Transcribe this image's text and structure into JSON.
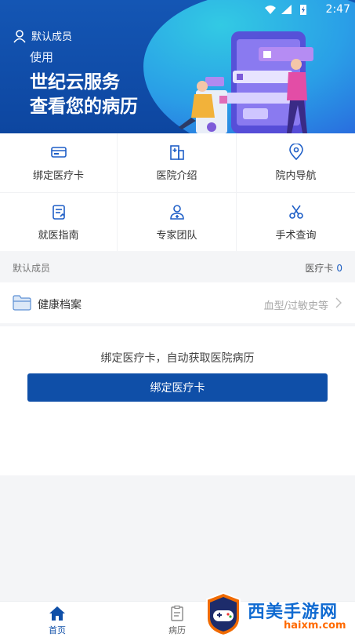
{
  "status": {
    "time": "2:47"
  },
  "hero": {
    "member_label": "默认成员",
    "use_text": "使用",
    "title_line1": "世纪云服务",
    "title_line2": "查看您的病历"
  },
  "grid": [
    {
      "label": "绑定医疗卡",
      "icon": "card-icon"
    },
    {
      "label": "医院介绍",
      "icon": "hospital-icon"
    },
    {
      "label": "院内导航",
      "icon": "location-icon"
    },
    {
      "label": "就医指南",
      "icon": "guide-icon"
    },
    {
      "label": "专家团队",
      "icon": "doctor-icon"
    },
    {
      "label": "手术查询",
      "icon": "scissors-icon"
    }
  ],
  "member_row": {
    "name": "默认成员",
    "card_label": "医疗卡",
    "card_count": "0"
  },
  "health": {
    "label": "健康档案",
    "hint": "血型/过敏史等"
  },
  "bind": {
    "message": "绑定医疗卡，自动获取医院病历",
    "button": "绑定医疗卡"
  },
  "tabbar": {
    "home": "首页",
    "record": "病历"
  },
  "watermark": {
    "brand": "西美手游网",
    "url": "haixm.com"
  },
  "colors": {
    "primary": "#0f4fa8",
    "hero": "#1456b4",
    "accent_cyan": "#34d0e6"
  }
}
